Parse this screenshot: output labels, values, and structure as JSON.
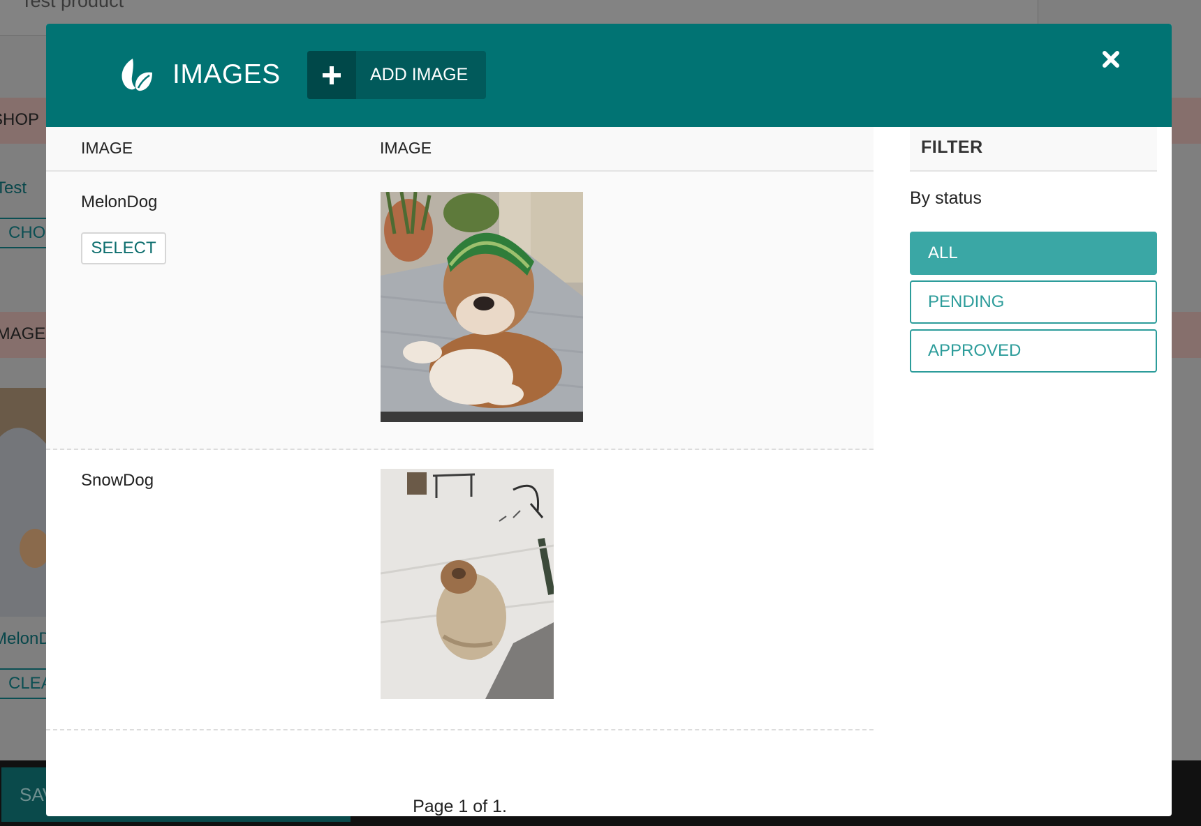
{
  "background": {
    "title": "Test product",
    "shop_label": "SHOP",
    "test_link": "Test",
    "choose_button": "CHOOSE",
    "image_label": "IMAGE",
    "melon_link": "MelonDog",
    "clear_button": "CLEAR",
    "save_button": "SAVE"
  },
  "modal": {
    "icon": "leaf-icon",
    "title": "IMAGES",
    "add_image_label": "ADD IMAGE",
    "close_icon": "close-icon"
  },
  "table": {
    "columns": [
      "IMAGE",
      "IMAGE"
    ],
    "rows": [
      {
        "name": "MelonDog",
        "select_label": "SELECT"
      },
      {
        "name": "SnowDog"
      }
    ],
    "pager": "Page 1 of 1."
  },
  "filter": {
    "title": "FILTER",
    "by_status": "By status",
    "options": [
      {
        "label": "ALL",
        "active": true
      },
      {
        "label": "PENDING",
        "active": false
      },
      {
        "label": "APPROVED",
        "active": false
      }
    ]
  },
  "colors": {
    "header": "#017373",
    "active_filter": "#3aa7a5",
    "accent": "#2c9c9a"
  }
}
